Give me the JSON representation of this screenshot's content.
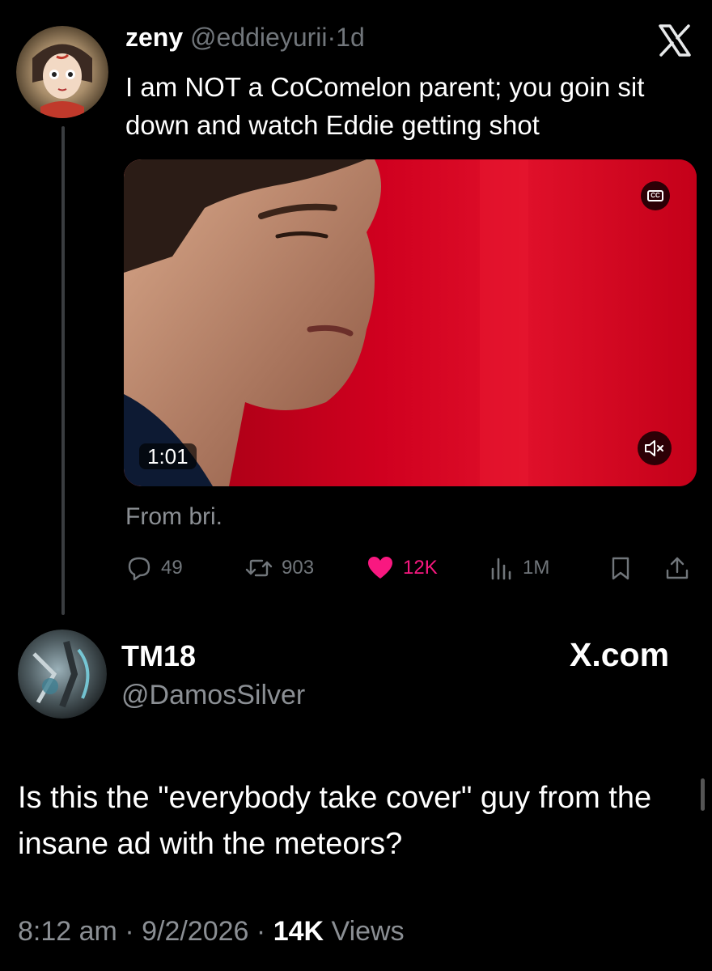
{
  "tweet": {
    "display_name": "zeny",
    "handle": "@eddieyurii",
    "separator": "·",
    "time": "1d",
    "text": "I am NOT a CoComelon parent; you goin sit down and watch Eddie getting shot",
    "video": {
      "duration": "1:01",
      "cc_label": "CC"
    },
    "caption": "From bri.",
    "actions": {
      "replies": "49",
      "reposts": "903",
      "likes": "12K",
      "views": "1M"
    },
    "icons": {
      "brand": "x-logo-icon",
      "reply": "reply-icon",
      "repost": "repost-icon",
      "like": "heart-icon",
      "views": "views-chart-icon",
      "bookmark": "bookmark-icon",
      "share": "share-icon",
      "captions": "closed-captions-icon",
      "mute": "muted-speaker-icon"
    },
    "like_color": "#f91880"
  },
  "reply": {
    "display_name": "TM18",
    "handle": "@DamosSilver",
    "brand_label": "X.com",
    "text": "Is this the \"everybody take cover\" guy from the insane ad with the meteors?",
    "time": "8:12 am",
    "sep1": "·",
    "date": "9/2/2026",
    "sep2": "·",
    "views_count": "14K",
    "views_label": "Views"
  },
  "colors": {
    "background": "#000000",
    "text": "#e7e9ea",
    "muted": "#71767b",
    "video_red": "#c3001c"
  }
}
